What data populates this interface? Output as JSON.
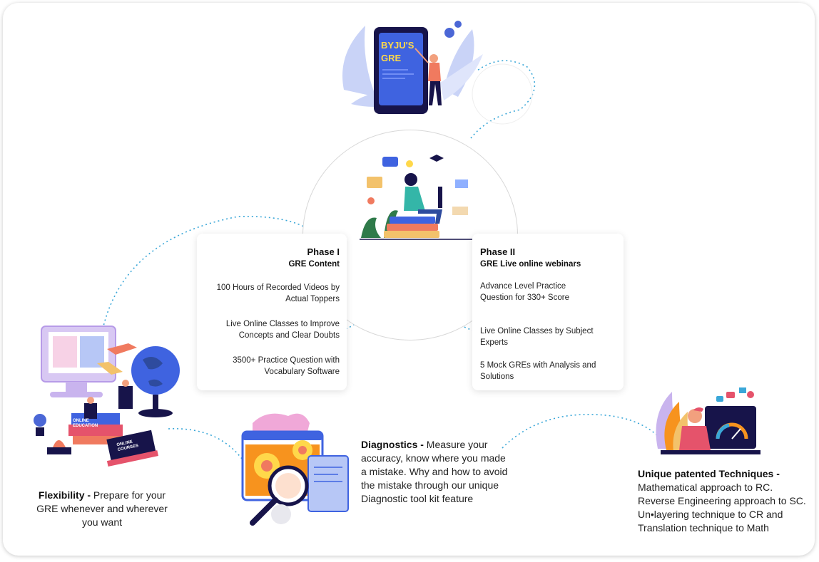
{
  "hero": {
    "tablet_brand": "BYJU'S",
    "tablet_sub": "GRE"
  },
  "phase1": {
    "title": "Phase I",
    "subtitle": "GRE Content",
    "items": [
      "100 Hours of Recorded Videos by Actual Toppers",
      "Live Online Classes to Improve Concepts and Clear Doubts",
      "3500+ Practice Question with Vocabulary Software"
    ]
  },
  "phase2": {
    "title": "Phase II",
    "subtitle": "GRE Live online webinars",
    "items": [
      "Advance Level Practice Question for 330+ Score",
      "Live Online Classes by Subject Experts",
      "5 Mock GREs with Analysis and Solutions"
    ]
  },
  "flexibility": {
    "heading": "Flexibility -",
    "body": " Prepare for your GRE whenever and wherever you want",
    "book1": "ONLINE EDUCATION",
    "book2": "ONLINE COURSES"
  },
  "diagnostics": {
    "heading": "Diagnostics -",
    "body": " Measure your accuracy, know where you made a mistake. Why and how to avoid the mistake through our unique Diagnostic tool kit feature"
  },
  "techniques": {
    "heading": "Unique patented Techniques -",
    "lines": [
      "Mathematical approach to RC.",
      "Reverse Engineering approach to SC.",
      "Un•layering technique to CR and",
      "Translation technique to Math"
    ]
  },
  "colors": {
    "accent_blue": "#3f63e0",
    "tablet_yellow": "#ffd84a",
    "dotted_line": "#3aa7d8"
  }
}
